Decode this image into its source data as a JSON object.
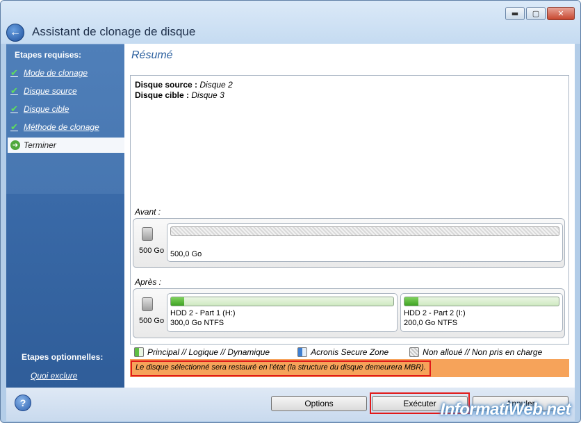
{
  "window": {
    "title": "Assistant de clonage de disque",
    "controls": {
      "minimize": "▬",
      "maximize": "▢",
      "close": "✕"
    }
  },
  "sidebar": {
    "required_header": "Etapes requises:",
    "items": [
      {
        "label": "Mode de clonage",
        "icon": "check-icon",
        "state": "done"
      },
      {
        "label": "Disque source",
        "icon": "check-icon",
        "state": "done"
      },
      {
        "label": "Disque cible",
        "icon": "check-icon",
        "state": "done"
      },
      {
        "label": "Méthode de clonage",
        "icon": "check-icon",
        "state": "done"
      },
      {
        "label": "Terminer",
        "icon": "arrow-right-icon",
        "state": "active"
      }
    ],
    "optional_header": "Etapes optionnelles:",
    "optional_items": [
      {
        "label": "Quoi exclure"
      }
    ]
  },
  "main": {
    "title": "Résumé",
    "source_label": "Disque source :",
    "source_value": "Disque 2",
    "target_label": "Disque cible :",
    "target_value": "Disque 3",
    "before": {
      "label": "Avant :",
      "disk_size": "500 Go",
      "partitions": [
        {
          "size": "500,0 Go",
          "type": "unallocated"
        }
      ]
    },
    "after": {
      "label": "Après :",
      "disk_size": "500 Go",
      "partitions": [
        {
          "name": "HDD 2 - Part 1 (H:)",
          "size": "300,0 Go  NTFS",
          "used_fraction": 0.06
        },
        {
          "name": "HDD 2 - Part 2 (I:)",
          "size": "200,0 Go  NTFS",
          "used_fraction": 0.09
        }
      ]
    },
    "legend": {
      "primary": "Principal // Logique // Dynamique",
      "secure": "Acronis Secure Zone",
      "unallocated": "Non alloué // Non pris en charge"
    },
    "warning": "Le disque sélectionné sera restauré en l'état (la structure du disque demeurera MBR)."
  },
  "footer": {
    "help": "?",
    "options_label": "Options",
    "execute_label": "Exécuter",
    "cancel_label": "Annuler"
  },
  "watermark": "InformatiWeb.net",
  "colors": {
    "accent": "#2b5f9e",
    "warning_bg": "#f6a35a",
    "highlight": "#e11a1a",
    "partition_green": "#3fa324"
  }
}
